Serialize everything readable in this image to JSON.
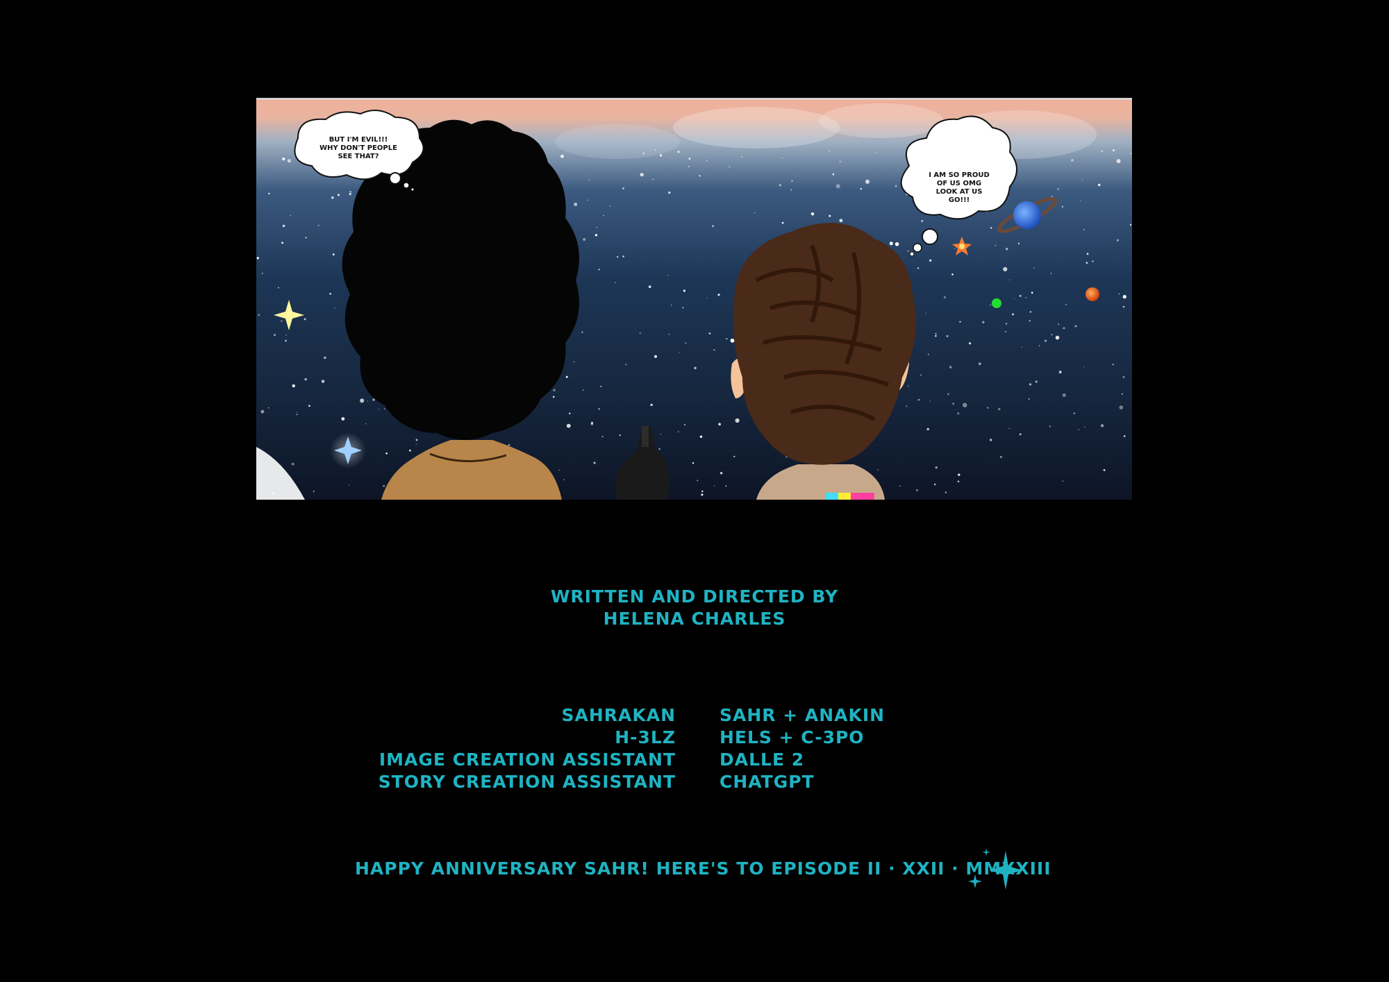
{
  "comic": {
    "left_thought": "But I'm Evil!!!\nWhy don't people\nsee that?",
    "right_thought": "I am so proud\nof us omg\nlook at us\ngo!!!"
  },
  "credits": {
    "directed_line1": "Written and Directed by",
    "directed_line2": "Helena Charles",
    "cast": [
      {
        "role": "Sahrakan",
        "name": "Sahr + Anakin"
      },
      {
        "role": "H-3LZ",
        "name": "Hels + C-3PO"
      },
      {
        "role": "Image Creation Assistant",
        "name": "Dalle 2"
      },
      {
        "role": "Story Creation Assistant",
        "name": "ChatGPT"
      }
    ],
    "footer": "Happy Anniversary Sahr!  Here's to Episode II · XXII · MMXXIII"
  },
  "colors": {
    "credit_text": "#1fb3c2",
    "background": "#000000"
  },
  "icons": [
    "sparkle-icon"
  ]
}
